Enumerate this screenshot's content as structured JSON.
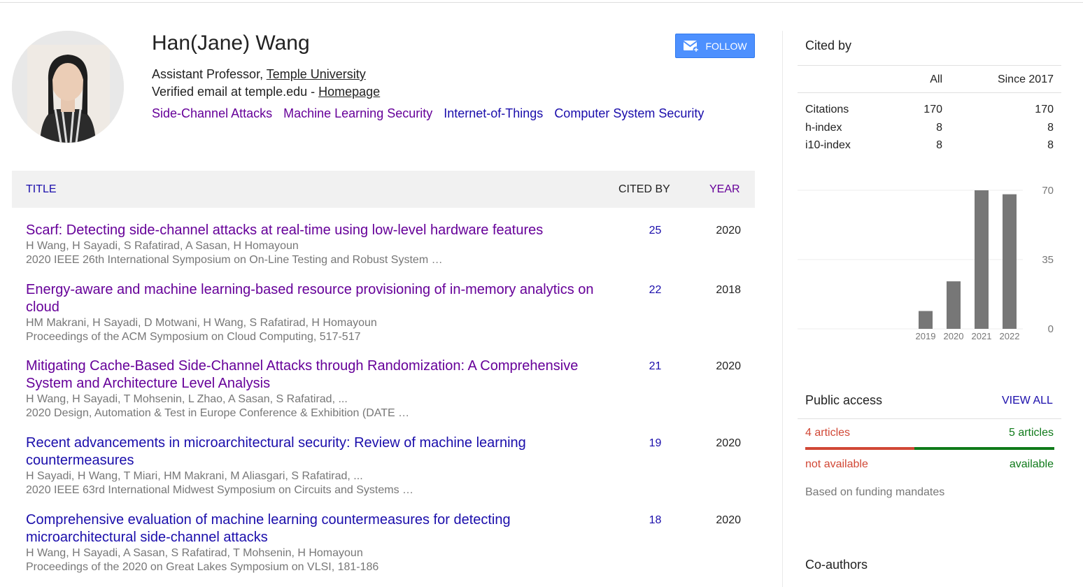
{
  "profile": {
    "name": "Han(Jane) Wang",
    "affiliation_prefix": "Assistant Professor, ",
    "affiliation_link": "Temple University",
    "email_prefix": "Verified email at temple.edu - ",
    "homepage_link": "Homepage",
    "interests": [
      "Side-Channel Attacks",
      "Machine Learning Security",
      "Internet-of-Things",
      "Computer System Security"
    ],
    "follow_label": "FOLLOW"
  },
  "table": {
    "col_title": "TITLE",
    "col_cited": "CITED BY",
    "col_year": "YEAR"
  },
  "articles": [
    {
      "title": "Scarf: Detecting side-channel attacks at real-time using low-level hardware features",
      "authors": "H Wang, H Sayadi, S Rafatirad, A Sasan, H Homayoun",
      "venue": "2020 IEEE 26th International Symposium on On-Line Testing and Robust System …",
      "cited": "25",
      "year": "2020"
    },
    {
      "title": "Energy-aware and machine learning-based resource provisioning of in-memory analytics on cloud",
      "authors": "HM Makrani, H Sayadi, D Motwani, H Wang, S Rafatirad, H Homayoun",
      "venue": "Proceedings of the ACM Symposium on Cloud Computing, 517-517",
      "cited": "22",
      "year": "2018"
    },
    {
      "title": "Mitigating Cache-Based Side-Channel Attacks through Randomization: A Comprehensive System and Architecture Level Analysis",
      "authors": "H Wang, H Sayadi, T Mohsenin, L Zhao, A Sasan, S Rafatirad, ...",
      "venue": "2020 Design, Automation & Test in Europe Conference & Exhibition (DATE …",
      "cited": "21",
      "year": "2020"
    },
    {
      "title": "Recent advancements in microarchitectural security: Review of machine learning countermeasures",
      "authors": "H Sayadi, H Wang, T Miari, HM Makrani, M Aliasgari, S Rafatirad, ...",
      "venue": "2020 IEEE 63rd International Midwest Symposium on Circuits and Systems …",
      "cited": "19",
      "year": "2020"
    },
    {
      "title": "Comprehensive evaluation of machine learning countermeasures for detecting microarchitectural side-channel attacks",
      "authors": "H Wang, H Sayadi, A Sasan, S Rafatirad, T Mohsenin, H Homayoun",
      "venue": "Proceedings of the 2020 on Great Lakes Symposium on VLSI, 181-186",
      "cited": "18",
      "year": "2020"
    }
  ],
  "cited_by": {
    "heading": "Cited by",
    "col_all": "All",
    "col_since": "Since 2017",
    "rows": [
      {
        "label": "Citations",
        "all": "170",
        "since": "170"
      },
      {
        "label": "h-index",
        "all": "8",
        "since": "8"
      },
      {
        "label": "i10-index",
        "all": "8",
        "since": "8"
      }
    ]
  },
  "chart_data": {
    "type": "bar",
    "categories": [
      "2019",
      "2020",
      "2021",
      "2022"
    ],
    "values": [
      9,
      24,
      70,
      68
    ],
    "ylim": [
      0,
      70
    ],
    "yticks": [
      "70",
      "35",
      "0"
    ],
    "bar_color": "#777777"
  },
  "public_access": {
    "heading": "Public access",
    "view_all": "VIEW ALL",
    "not_available_count": "4 articles",
    "available_count": "5 articles",
    "not_available_label": "not available",
    "available_label": "available",
    "note": "Based on funding mandates",
    "not_available_color": "#d14836",
    "available_color": "#0f7a1a"
  },
  "coauthors": {
    "heading": "Co-authors"
  }
}
